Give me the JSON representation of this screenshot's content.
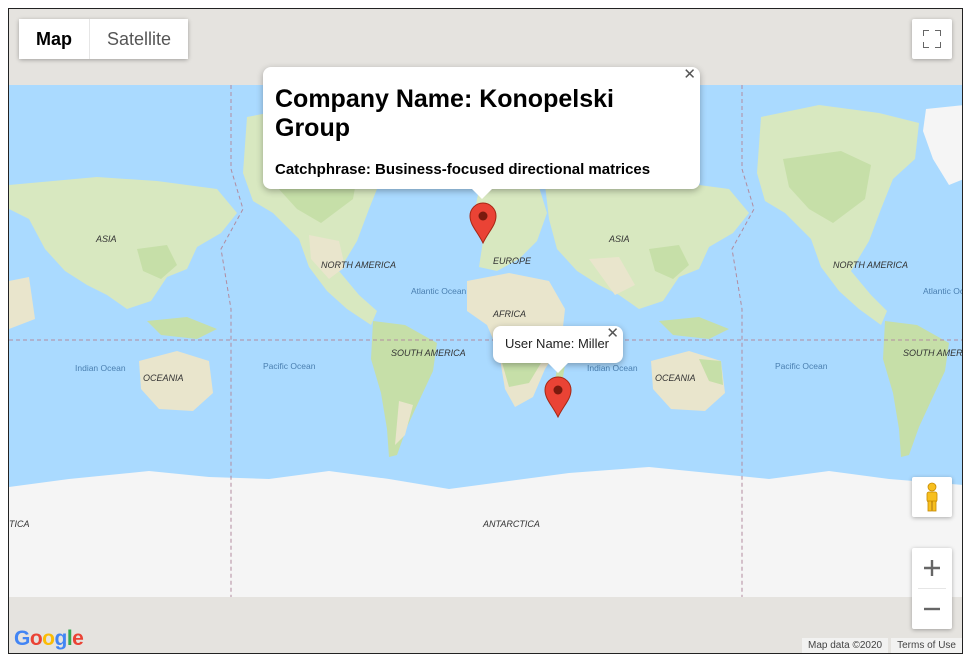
{
  "map_type": {
    "options": [
      "Map",
      "Satellite"
    ],
    "selected": "Map"
  },
  "info_windows": {
    "company": {
      "title": "Company Name: Konopelski Group",
      "subtitle": "Catchphrase: Business-focused directional matrices"
    },
    "user": {
      "label": "User Name: Miller"
    }
  },
  "map_labels": {
    "asia": "ASIA",
    "north_america": "NORTH AMERICA",
    "europe": "EUROPE",
    "africa": "AFRICA",
    "south_america": "SOUTH AMERICA",
    "oceania": "OCEANIA",
    "antarctica": "ANTARCTICA",
    "atlantic_ocean": "Atlantic Ocean",
    "indian_ocean": "Indian Ocean",
    "pacific_ocean": "Pacific Ocean",
    "antarctica_partial": "TICA"
  },
  "markers": [
    {
      "name": "company-marker",
      "lat": 59.0,
      "lng": -29.0
    },
    {
      "name": "user-marker",
      "lat": -37.0,
      "lng": 33.0
    }
  ],
  "footer": {
    "map_data": "Map data ©2020",
    "terms": "Terms of Use"
  },
  "google_logo": "Google",
  "colors": {
    "water": "#aadaff",
    "land": "#e8eed8",
    "forest": "#c6dfa8",
    "ice": "#f5f5f5",
    "marker": "#ea4335",
    "marker_dark": "#a52714"
  }
}
